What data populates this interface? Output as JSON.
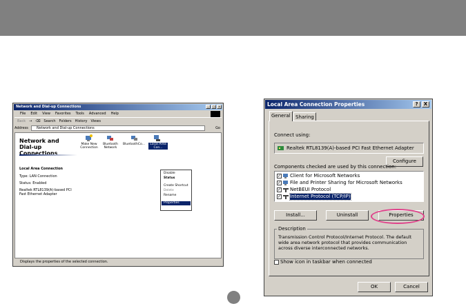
{
  "left_window": {
    "title": "Network and Dial-up Connections",
    "menu": [
      "File",
      "Edit",
      "View",
      "Favorites",
      "Tools",
      "Advanced",
      "Help"
    ],
    "toolbar": {
      "back": "Back",
      "forward": "→",
      "up": "⌫",
      "search": "Search",
      "folders": "Folders",
      "history": "History",
      "views": "Views"
    },
    "address_label": "Address",
    "address_value": "Network and Dial-up Connections",
    "go_label": "Go",
    "pane_title": "Network and Dial-up Connections",
    "selected_name": "Local Area Connection",
    "info_type": "Type: LAN Connection",
    "info_status": "Status: Enabled",
    "info_adapter": "Realtek RTL8139(A)-based PCI Fast Ethernet Adapter",
    "icons": [
      {
        "label": "Make New Connection"
      },
      {
        "label": "Bluetooth Network"
      },
      {
        "label": "BluetoothCo..."
      },
      {
        "label": "Local Area Con..."
      }
    ],
    "context_menu": [
      "Disable",
      "Status",
      "Create Shortcut",
      "Delete",
      "Rename",
      "Properties"
    ],
    "status_bar": "Displays the properties of the selected connection."
  },
  "dialog": {
    "title": "Local Area Connection Properties",
    "help_btn": "?",
    "close_btn": "X",
    "tabs": [
      "General",
      "Sharing"
    ],
    "connect_using_label": "Connect using:",
    "adapter": "Realtek RTL8139(A)-based PCI Fast Ethernet Adapter",
    "configure_button": "Configure",
    "components_label": "Components checked are used by this connection:",
    "components": [
      {
        "label": "Client for Microsoft Networks",
        "checked": true
      },
      {
        "label": "File and Printer Sharing for Microsoft Networks",
        "checked": true
      },
      {
        "label": "NetBEUI Protocol",
        "checked": true
      },
      {
        "label": "Internet Protocol (TCP/IP)",
        "checked": true
      }
    ],
    "install_button": "Install...",
    "uninstall_button": "Uninstall",
    "properties_button": "Properties",
    "description_label": "Description",
    "description_text": "Transmission Control Protocol/Internet Protocol. The default wide area network protocol that provides communication across diverse interconnected networks.",
    "show_icon_label": "Show icon in taskbar when connected",
    "ok_button": "OK",
    "cancel_button": "Cancel"
  },
  "colors": {
    "highlight_circle": "#e0408a",
    "title_blue": "#0a246a",
    "header_gray": "#808080"
  }
}
